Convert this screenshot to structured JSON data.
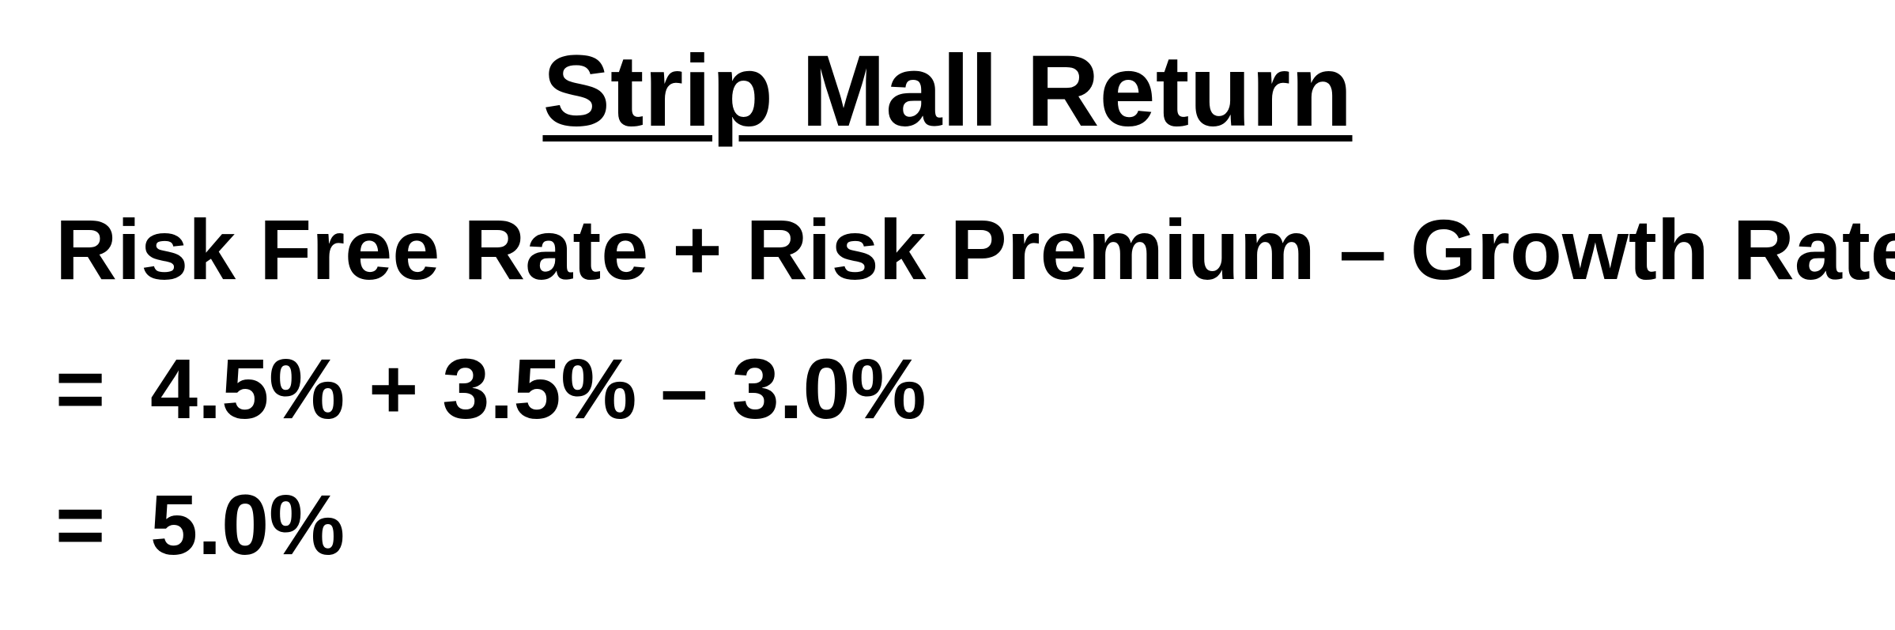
{
  "title": "Strip Mall Return",
  "formula": "Risk Free Rate + Risk Premium – Growth Rate",
  "substitution": {
    "equals": "=",
    "expression": "4.5% + 3.5% – 3.0%"
  },
  "result": {
    "equals": "=",
    "value": "5.0%"
  }
}
